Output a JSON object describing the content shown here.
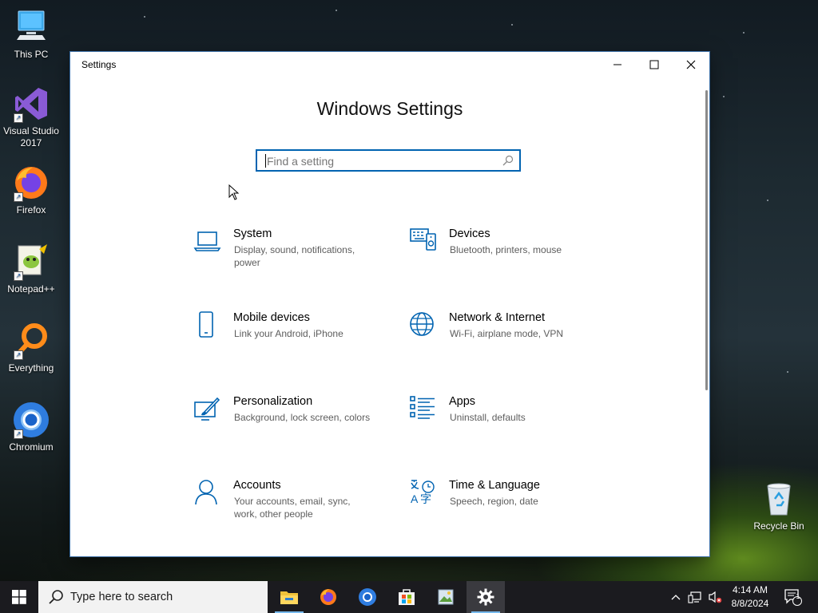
{
  "desktop": {
    "icons": [
      {
        "label": "This PC",
        "icon": "computer-icon"
      },
      {
        "label": "Visual Studio 2017",
        "icon": "visual-studio-icon"
      },
      {
        "label": "Firefox",
        "icon": "firefox-icon"
      },
      {
        "label": "Notepad++",
        "icon": "notepad-plus-plus-icon"
      },
      {
        "label": "Everything",
        "icon": "everything-search-icon"
      },
      {
        "label": "Chromium",
        "icon": "chromium-icon"
      },
      {
        "label": "Recycle Bin",
        "icon": "recycle-bin-icon"
      }
    ]
  },
  "window": {
    "title": "Settings",
    "heading": "Windows Settings",
    "search_placeholder": "Find a setting",
    "accent": "#0063b1",
    "categories": [
      {
        "title": "System",
        "desc": "Display, sound, notifications, power",
        "icon": "laptop-icon"
      },
      {
        "title": "Devices",
        "desc": "Bluetooth, printers, mouse",
        "icon": "devices-icon"
      },
      {
        "title": "Mobile devices",
        "desc": "Link your Android, iPhone",
        "icon": "phone-icon"
      },
      {
        "title": "Network & Internet",
        "desc": "Wi-Fi, airplane mode, VPN",
        "icon": "globe-icon"
      },
      {
        "title": "Personalization",
        "desc": "Background, lock screen, colors",
        "icon": "paint-brush-icon"
      },
      {
        "title": "Apps",
        "desc": "Uninstall, defaults",
        "icon": "apps-list-icon"
      },
      {
        "title": "Accounts",
        "desc": "Your accounts, email, sync, work, other people",
        "icon": "person-icon"
      },
      {
        "title": "Time & Language",
        "desc": "Speech, region, date",
        "icon": "time-language-icon"
      }
    ]
  },
  "taskbar": {
    "search_text": "Type here to search",
    "apps": [
      "file-explorer-icon",
      "firefox-icon",
      "chromium-icon",
      "store-icon",
      "photos-icon",
      "settings-gear-icon"
    ],
    "time": "4:14 AM",
    "date": "8/8/2024",
    "notification_count": "1"
  }
}
